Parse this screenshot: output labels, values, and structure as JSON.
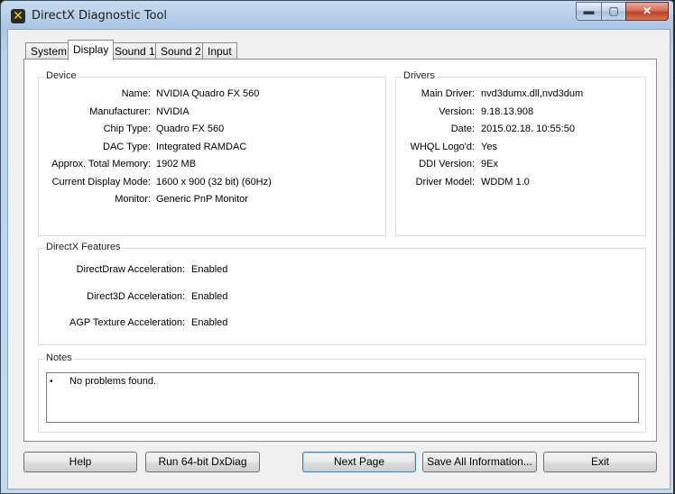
{
  "window": {
    "title": "DirectX Diagnostic Tool",
    "icon_glyph": "✕"
  },
  "controls": {
    "minimize": "▬",
    "maximize": "▢",
    "close": "✕"
  },
  "tabs": [
    {
      "label": "System"
    },
    {
      "label": "Display"
    },
    {
      "label": "Sound 1"
    },
    {
      "label": "Sound 2"
    },
    {
      "label": "Input"
    }
  ],
  "device": {
    "title": "Device",
    "rows": [
      {
        "label": "Name:",
        "value": "NVIDIA Quadro FX 560"
      },
      {
        "label": "Manufacturer:",
        "value": "NVIDIA"
      },
      {
        "label": "Chip Type:",
        "value": "Quadro FX 560"
      },
      {
        "label": "DAC Type:",
        "value": "Integrated RAMDAC"
      },
      {
        "label": "Approx. Total Memory:",
        "value": "1902 MB"
      },
      {
        "label": "Current Display Mode:",
        "value": "1600 x 900 (32 bit) (60Hz)"
      },
      {
        "label": "Monitor:",
        "value": "Generic PnP Monitor"
      }
    ]
  },
  "drivers": {
    "title": "Drivers",
    "rows": [
      {
        "label": "Main Driver:",
        "value": "nvd3dumx.dll,nvd3dum"
      },
      {
        "label": "Version:",
        "value": "9.18.13.908"
      },
      {
        "label": "Date:",
        "value": "2015.02.18. 10:55:50"
      },
      {
        "label": "WHQL Logo'd:",
        "value": "Yes"
      },
      {
        "label": "DDI Version:",
        "value": "9Ex"
      },
      {
        "label": "Driver Model:",
        "value": "WDDM 1.0"
      }
    ]
  },
  "features": {
    "title": "DirectX Features",
    "rows": [
      {
        "label": "DirectDraw Acceleration:",
        "value": "Enabled"
      },
      {
        "label": "Direct3D Acceleration:",
        "value": "Enabled"
      },
      {
        "label": "AGP Texture Acceleration:",
        "value": "Enabled"
      }
    ]
  },
  "notes": {
    "title": "Notes",
    "bullet": "•",
    "items": [
      "No problems found."
    ]
  },
  "buttons": {
    "help": "Help",
    "run64": "Run 64-bit DxDiag",
    "next": "Next Page",
    "save": "Save All Information...",
    "exit": "Exit"
  }
}
